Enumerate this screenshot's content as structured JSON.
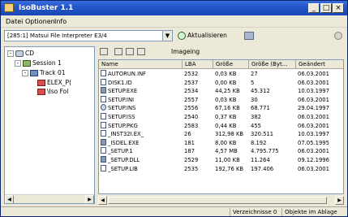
{
  "window": {
    "title": "IsoBuster 1.1"
  },
  "menubar": {
    "items": [
      "Datei",
      "Optionen",
      "Info"
    ]
  },
  "addressbar": {
    "drive": "[285:1] Matsui  File Interpreter  E3/4",
    "refresh_label": "Aktualisieren"
  },
  "tree": {
    "items": [
      {
        "label": "CD",
        "level": 0,
        "icon": "cd-icon",
        "expander": "-"
      },
      {
        "label": "Session 1",
        "level": 1,
        "icon": "session-icon",
        "expander": "-"
      },
      {
        "label": "Track 01",
        "level": 2,
        "icon": "track-icon",
        "expander": "-"
      },
      {
        "label": "ELEX_P(",
        "level": 3,
        "icon": "folder-icon",
        "expander": ""
      },
      {
        "label": "\\Iso Fol",
        "level": 3,
        "icon": "folder-icon",
        "expander": ""
      }
    ]
  },
  "right_toolbar": {
    "label": "Imageing"
  },
  "list": {
    "columns": [
      "Name",
      "LBA",
      "Größe",
      "Größe (Byt...",
      "Geändert"
    ],
    "rows": [
      {
        "name": "AUTORUN.INF",
        "lba": "2532",
        "size": "0,03 KB",
        "bytes": "27",
        "date": "06.03.2001",
        "icon": "file"
      },
      {
        "name": "DISK1.ID",
        "lba": "2537",
        "size": "0,00 KB",
        "bytes": "5",
        "date": "06.03.2001",
        "icon": "file"
      },
      {
        "name": "SETUP.EXE",
        "lba": "2534",
        "size": "44,25 KB",
        "bytes": "45.312",
        "date": "10.03.1997",
        "icon": "sys"
      },
      {
        "name": "SETUP.INI",
        "lba": "2557",
        "size": "0,03 KB",
        "bytes": "30",
        "date": "06.03.2001",
        "icon": "file"
      },
      {
        "name": "SETUP.INS",
        "lba": "2556",
        "size": "67,16 KB",
        "bytes": "68.771",
        "date": "29.04.1997",
        "icon": "cd"
      },
      {
        "name": "SETUP.ISS",
        "lba": "2540",
        "size": "0,37 KB",
        "bytes": "382",
        "date": "06.03.2001",
        "icon": "file"
      },
      {
        "name": "SETUP.PKG",
        "lba": "2583",
        "size": "0,44 KB",
        "bytes": "455",
        "date": "06.03.2001",
        "icon": "file"
      },
      {
        "name": "_INST32I.EX_",
        "lba": "26",
        "size": "312,98 KB",
        "bytes": "320.511",
        "date": "10.03.1997",
        "icon": "file"
      },
      {
        "name": "_ISDEL.EXE",
        "lba": "181",
        "size": "8,00 KB",
        "bytes": "8.192",
        "date": "07.05.1995",
        "icon": "sys"
      },
      {
        "name": "_SETUP.1",
        "lba": "187",
        "size": "4,57 MB",
        "bytes": "4.795.775",
        "date": "06.03.2001",
        "icon": "file"
      },
      {
        "name": "_SETUP.DLL",
        "lba": "2529",
        "size": "11,00 KB",
        "bytes": "11.264",
        "date": "09.12.1996",
        "icon": "sys"
      },
      {
        "name": "_SETUP.LIB",
        "lba": "2535",
        "size": "192,76 KB",
        "bytes": "197.406",
        "date": "06.03.2001",
        "icon": "file"
      }
    ]
  },
  "statusbar": {
    "left": "Verzeichnisse 0",
    "right": "Objekte im Ablage"
  }
}
